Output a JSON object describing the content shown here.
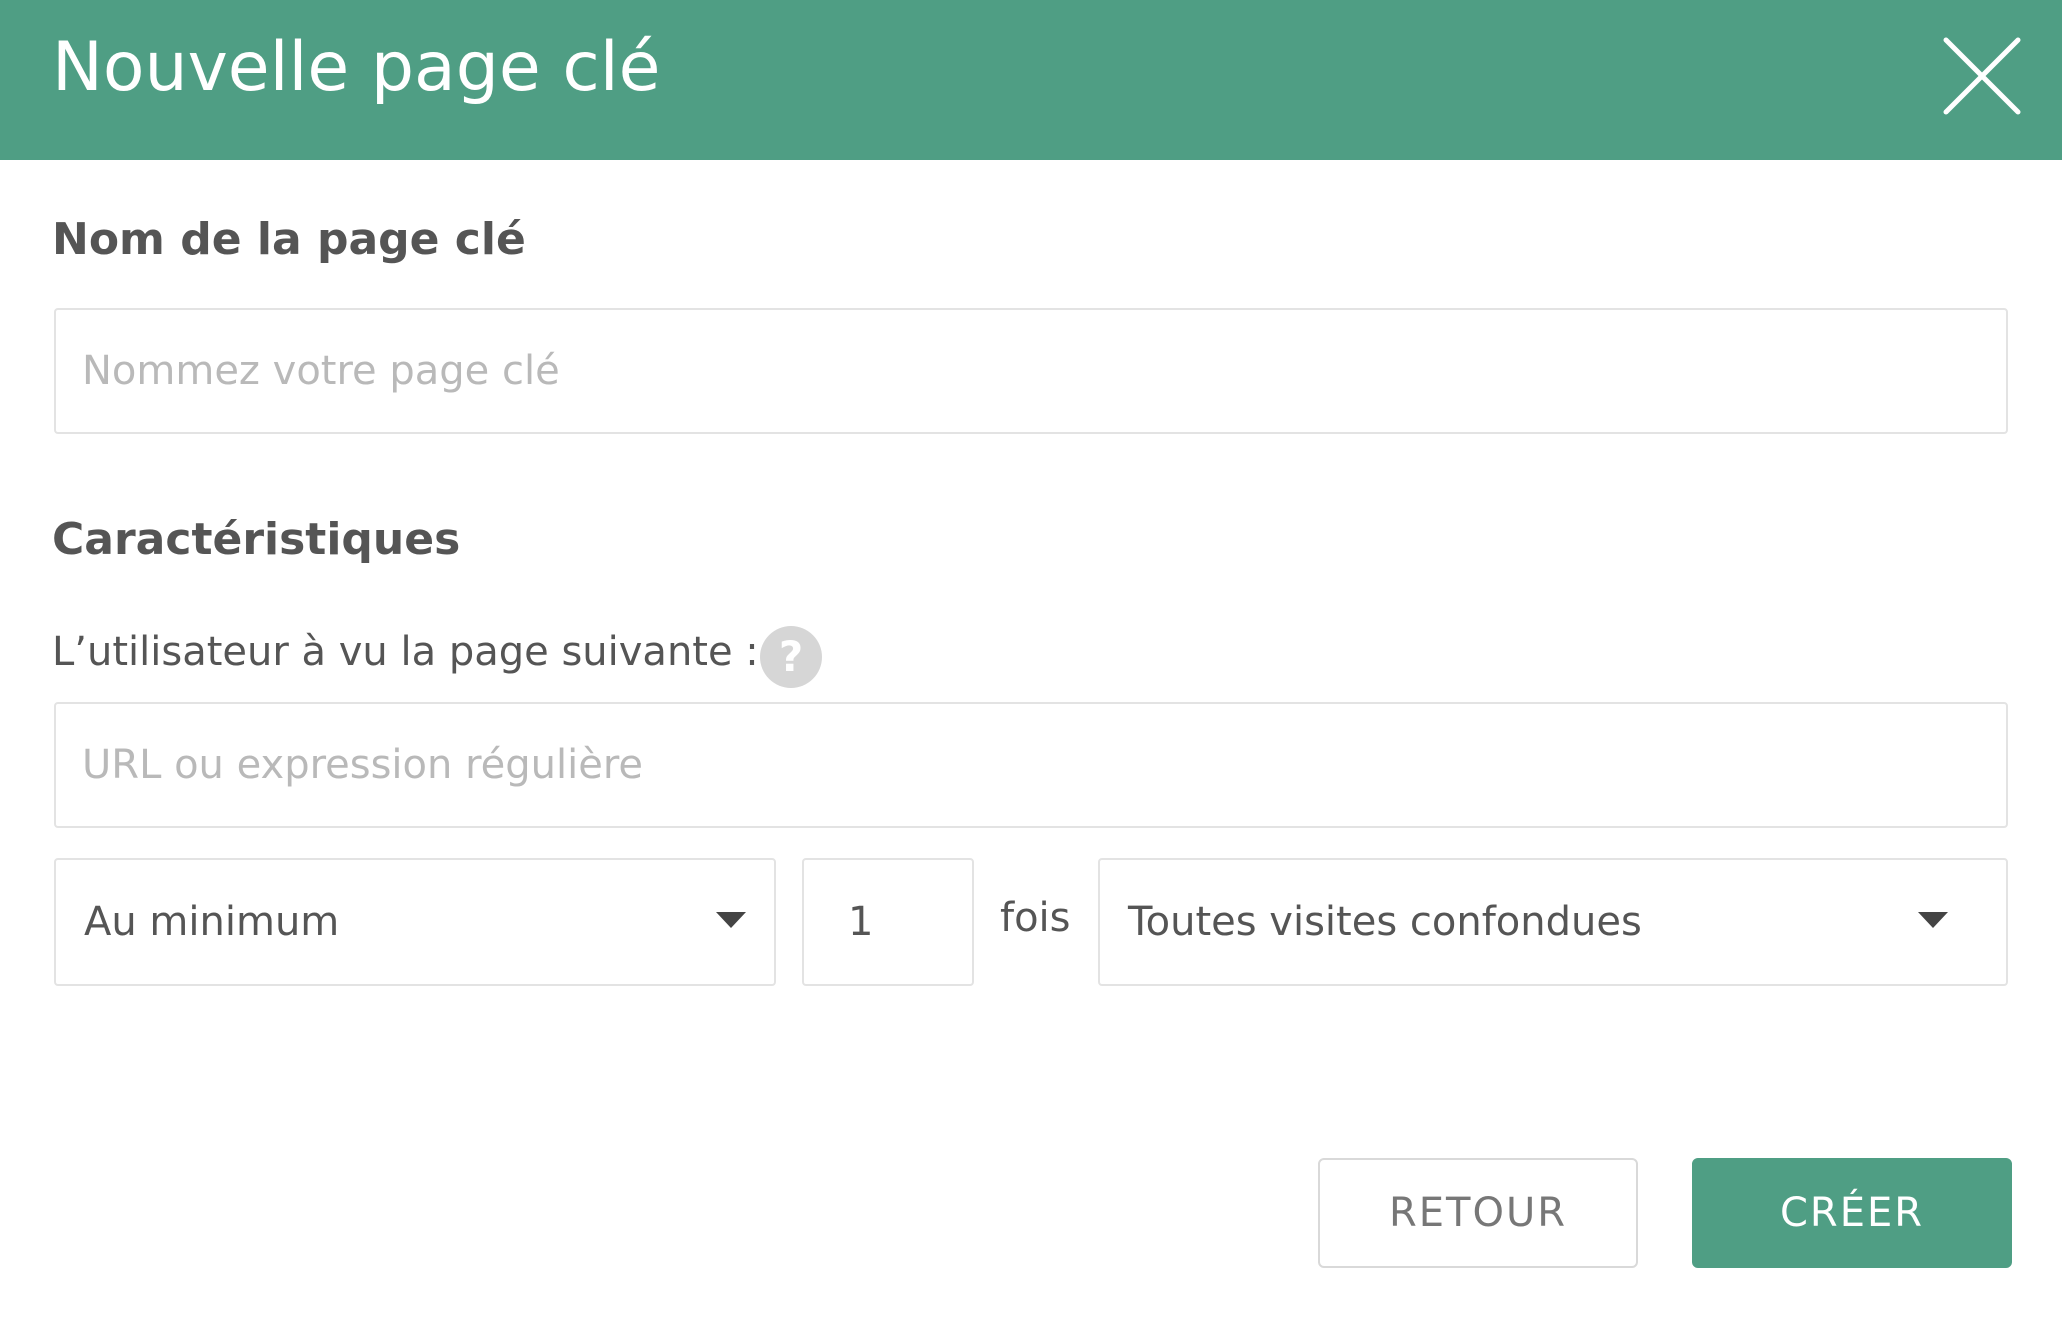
{
  "dialog": {
    "title": "Nouvelle page clé",
    "accent_color": "#4f9e84"
  },
  "name_section": {
    "label": "Nom de la page clé",
    "input_value": "",
    "input_placeholder": "Nommez votre page clé"
  },
  "characteristics": {
    "title": "Caractéristiques",
    "page_viewed_label": "L’utilisateur à vu la page suivante :",
    "help_icon_glyph": "?",
    "url_value": "",
    "url_placeholder": "URL ou expression régulière",
    "frequency_select": "Au minimum",
    "count_value": "1",
    "times_label": "fois",
    "visits_select": "Toutes visites confondues"
  },
  "footer": {
    "back_label": "RETOUR",
    "create_label": "CRÉER"
  }
}
